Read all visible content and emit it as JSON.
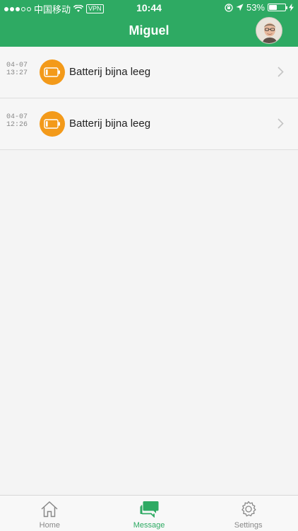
{
  "status_bar": {
    "carrier": "中国移动",
    "vpn": "VPN",
    "time": "10:44",
    "battery_percent": "53%",
    "battery_level": 0.53
  },
  "nav": {
    "title": "Miguel"
  },
  "messages": [
    {
      "date": "04-07",
      "time": "13:27",
      "title": "Batterij bijna leeg",
      "icon": "battery-low-icon"
    },
    {
      "date": "04-07",
      "time": "12:26",
      "title": "Batterij bijna leeg",
      "icon": "battery-low-icon"
    }
  ],
  "tabs": [
    {
      "label": "Home",
      "icon": "home-icon",
      "active": false
    },
    {
      "label": "Message",
      "icon": "message-icon",
      "active": true
    },
    {
      "label": "Settings",
      "icon": "gear-icon",
      "active": false
    }
  ],
  "colors": {
    "primary": "#2eaa63",
    "alert_badge": "#f39a1a"
  }
}
